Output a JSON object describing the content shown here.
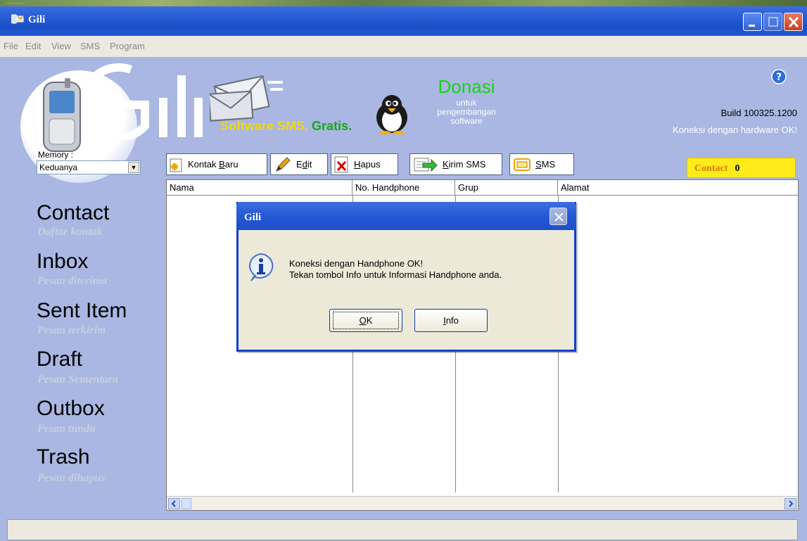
{
  "window": {
    "title": "Gili"
  },
  "desktop": {
    "strip_text": "........"
  },
  "menu": [
    "File",
    "Edit",
    "View",
    "SMS",
    "Program"
  ],
  "banner": {
    "slogan_part1": "Software SMS.",
    "slogan_part2": "Gratis.",
    "donasi": "Donasi",
    "donasi_sub": [
      "untuk",
      "pengembangan",
      "software"
    ],
    "build": "Build 100325.1200",
    "hw_status": "Koneksi dengan hardware OK!"
  },
  "memory": {
    "label": "Memory :",
    "value": "Keduanya"
  },
  "nav": [
    {
      "title": "Contact",
      "sub": "Daftar kontak"
    },
    {
      "title": "Inbox",
      "sub": "Pesan diterima"
    },
    {
      "title": "Sent Item",
      "sub": "Pesan terkirim"
    },
    {
      "title": "Draft",
      "sub": "Pesan Sementara"
    },
    {
      "title": "Outbox",
      "sub": "Pesan tunda"
    },
    {
      "title": "Trash",
      "sub": "Pesan dihapus"
    }
  ],
  "toolbar": {
    "kontak_baru": {
      "pre": "Kontak ",
      "u": "B",
      "post": "aru"
    },
    "edit": {
      "pre": "E",
      "u": "d",
      "post": "it"
    },
    "hapus": {
      "pre": "",
      "u": "H",
      "post": "apus"
    },
    "kirim_sms": {
      "pre": "",
      "u": "K",
      "post": "irim SMS"
    },
    "sms": {
      "pre": "",
      "u": "S",
      "post": "MS"
    }
  },
  "contact_counter": {
    "label": "Contact",
    "value": "0"
  },
  "table": {
    "columns": [
      "Nama",
      "No. Handphone",
      "Grup",
      "Alamat"
    ]
  },
  "dialog": {
    "title": "Gili",
    "message_line1": "Koneksi dengan Handphone OK!",
    "message_line2": "Tekan tombol Info untuk Informasi Handphone anda.",
    "ok": {
      "u": "O",
      "post": "K"
    },
    "info": {
      "u": "I",
      "post": "nfo"
    }
  },
  "icons": [
    "app-icon",
    "minimize-icon",
    "maximize-icon",
    "close-icon",
    "help-icon",
    "new-contact-icon",
    "edit-pencil-icon",
    "delete-x-icon",
    "send-sms-icon",
    "sms-icon",
    "info-icon"
  ]
}
